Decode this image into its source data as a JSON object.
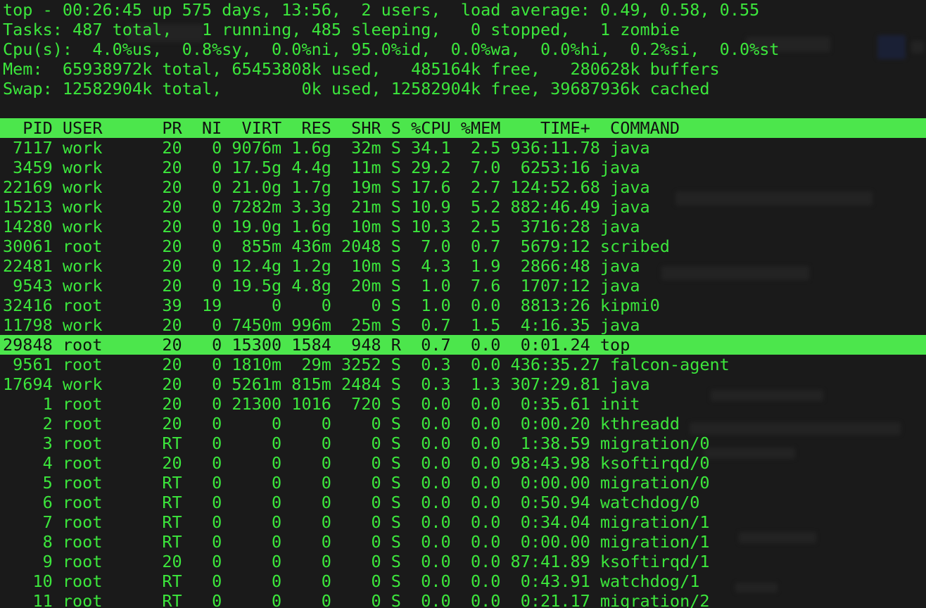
{
  "terminal": {
    "title": "top",
    "colors": {
      "background": "#1a1a1a",
      "foreground": "#3ce63c",
      "reverse_background": "#4ce64c",
      "reverse_foreground": "#111111"
    }
  },
  "summary": {
    "uptime_line": "top - 00:26:45 up 575 days, 13:56,  2 users,  load average: 0.49, 0.58, 0.55",
    "tasks_line": "Tasks: 487 total,   1 running, 485 sleeping,   0 stopped,   1 zombie",
    "cpu_line": "Cpu(s):  4.0%us,  0.8%sy,  0.0%ni, 95.0%id,  0.0%wa,  0.0%hi,  0.2%si,  0.0%st",
    "mem_line": "Mem:  65938972k total, 65453808k used,   485164k free,   280628k buffers",
    "swap_line": "Swap: 12582904k total,        0k used, 12582904k free, 39687936k cached",
    "fields": {
      "time": "00:26:45",
      "up": "575 days, 13:56",
      "users": "2",
      "load_average": [
        "0.49",
        "0.58",
        "0.55"
      ],
      "tasks_total": "487",
      "tasks_running": "1",
      "tasks_sleeping": "485",
      "tasks_stopped": "0",
      "tasks_zombie": "1",
      "cpu_us": "4.0",
      "cpu_sy": "0.8",
      "cpu_ni": "0.0",
      "cpu_id": "95.0",
      "cpu_wa": "0.0",
      "cpu_hi": "0.0",
      "cpu_si": "0.2",
      "cpu_st": "0.0",
      "mem_total": "65938972k",
      "mem_used": "65453808k",
      "mem_free": "485164k",
      "mem_buffers": "280628k",
      "swap_total": "12582904k",
      "swap_used": "0k",
      "swap_free": "12582904k",
      "swap_cached": "39687936k"
    }
  },
  "table": {
    "header_line": "  PID USER      PR  NI  VIRT  RES  SHR S %CPU %MEM    TIME+  COMMAND                 ",
    "columns": [
      "PID",
      "USER",
      "PR",
      "NI",
      "VIRT",
      "RES",
      "SHR",
      "S",
      "%CPU",
      "%MEM",
      "TIME+",
      "COMMAND"
    ],
    "selected_row_index": 10,
    "rows": [
      {
        "line": " 7117 work      20   0 9076m 1.6g  32m S 34.1  2.5 936:11.78 java",
        "pid": "7117",
        "user": "work",
        "pr": "20",
        "ni": "0",
        "virt": "9076m",
        "res": "1.6g",
        "shr": "32m",
        "s": "S",
        "cpu": "34.1",
        "mem": "2.5",
        "time": "936:11.78",
        "command": "java"
      },
      {
        "line": " 3459 work      20   0 17.5g 4.4g  11m S 29.2  7.0  6253:16 java",
        "pid": "3459",
        "user": "work",
        "pr": "20",
        "ni": "0",
        "virt": "17.5g",
        "res": "4.4g",
        "shr": "11m",
        "s": "S",
        "cpu": "29.2",
        "mem": "7.0",
        "time": "6253:16",
        "command": "java"
      },
      {
        "line": "22169 work      20   0 21.0g 1.7g  19m S 17.6  2.7 124:52.68 java",
        "pid": "22169",
        "user": "work",
        "pr": "20",
        "ni": "0",
        "virt": "21.0g",
        "res": "1.7g",
        "shr": "19m",
        "s": "S",
        "cpu": "17.6",
        "mem": "2.7",
        "time": "124:52.68",
        "command": "java"
      },
      {
        "line": "15213 work      20   0 7282m 3.3g  21m S 10.9  5.2 882:46.49 java",
        "pid": "15213",
        "user": "work",
        "pr": "20",
        "ni": "0",
        "virt": "7282m",
        "res": "3.3g",
        "shr": "21m",
        "s": "S",
        "cpu": "10.9",
        "mem": "5.2",
        "time": "882:46.49",
        "command": "java"
      },
      {
        "line": "14280 work      20   0 19.0g 1.6g  10m S 10.3  2.5  3716:28 java",
        "pid": "14280",
        "user": "work",
        "pr": "20",
        "ni": "0",
        "virt": "19.0g",
        "res": "1.6g",
        "shr": "10m",
        "s": "S",
        "cpu": "10.3",
        "mem": "2.5",
        "time": "3716:28",
        "command": "java"
      },
      {
        "line": "30061 root      20   0  855m 436m 2048 S  7.0  0.7  5679:12 scribed",
        "pid": "30061",
        "user": "root",
        "pr": "20",
        "ni": "0",
        "virt": "855m",
        "res": "436m",
        "shr": "2048",
        "s": "S",
        "cpu": "7.0",
        "mem": "0.7",
        "time": "5679:12",
        "command": "scribed"
      },
      {
        "line": "22481 work      20   0 12.4g 1.2g  10m S  4.3  1.9  2866:48 java",
        "pid": "22481",
        "user": "work",
        "pr": "20",
        "ni": "0",
        "virt": "12.4g",
        "res": "1.2g",
        "shr": "10m",
        "s": "S",
        "cpu": "4.3",
        "mem": "1.9",
        "time": "2866:48",
        "command": "java"
      },
      {
        "line": " 9543 work      20   0 19.5g 4.8g  20m S  1.0  7.6  1707:12 java",
        "pid": "9543",
        "user": "work",
        "pr": "20",
        "ni": "0",
        "virt": "19.5g",
        "res": "4.8g",
        "shr": "20m",
        "s": "S",
        "cpu": "1.0",
        "mem": "7.6",
        "time": "1707:12",
        "command": "java"
      },
      {
        "line": "32416 root      39  19     0    0    0 S  1.0  0.0  8813:26 kipmi0",
        "pid": "32416",
        "user": "root",
        "pr": "39",
        "ni": "19",
        "virt": "0",
        "res": "0",
        "shr": "0",
        "s": "S",
        "cpu": "1.0",
        "mem": "0.0",
        "time": "8813:26",
        "command": "kipmi0"
      },
      {
        "line": "11798 work      20   0 7450m 996m  25m S  0.7  1.5  4:16.35 java",
        "pid": "11798",
        "user": "work",
        "pr": "20",
        "ni": "0",
        "virt": "7450m",
        "res": "996m",
        "shr": "25m",
        "s": "S",
        "cpu": "0.7",
        "mem": "1.5",
        "time": "4:16.35",
        "command": "java"
      },
      {
        "line": "29848 root      20   0 15300 1584  948 R  0.7  0.0  0:01.24 top",
        "pid": "29848",
        "user": "root",
        "pr": "20",
        "ni": "0",
        "virt": "15300",
        "res": "1584",
        "shr": "948",
        "s": "R",
        "cpu": "0.7",
        "mem": "0.0",
        "time": "0:01.24",
        "command": "top"
      },
      {
        "line": " 9561 root      20   0 1810m  29m 3252 S  0.3  0.0 436:35.27 falcon-agent",
        "pid": "9561",
        "user": "root",
        "pr": "20",
        "ni": "0",
        "virt": "1810m",
        "res": "29m",
        "shr": "3252",
        "s": "S",
        "cpu": "0.3",
        "mem": "0.0",
        "time": "436:35.27",
        "command": "falcon-agent"
      },
      {
        "line": "17694 work      20   0 5261m 815m 2484 S  0.3  1.3 307:29.81 java",
        "pid": "17694",
        "user": "work",
        "pr": "20",
        "ni": "0",
        "virt": "5261m",
        "res": "815m",
        "shr": "2484",
        "s": "S",
        "cpu": "0.3",
        "mem": "1.3",
        "time": "307:29.81",
        "command": "java"
      },
      {
        "line": "    1 root      20   0 21300 1016  720 S  0.0  0.0  0:35.61 init",
        "pid": "1",
        "user": "root",
        "pr": "20",
        "ni": "0",
        "virt": "21300",
        "res": "1016",
        "shr": "720",
        "s": "S",
        "cpu": "0.0",
        "mem": "0.0",
        "time": "0:35.61",
        "command": "init"
      },
      {
        "line": "    2 root      20   0     0    0    0 S  0.0  0.0  0:00.20 kthreadd",
        "pid": "2",
        "user": "root",
        "pr": "20",
        "ni": "0",
        "virt": "0",
        "res": "0",
        "shr": "0",
        "s": "S",
        "cpu": "0.0",
        "mem": "0.0",
        "time": "0:00.20",
        "command": "kthreadd"
      },
      {
        "line": "    3 root      RT   0     0    0    0 S  0.0  0.0  1:38.59 migration/0",
        "pid": "3",
        "user": "root",
        "pr": "RT",
        "ni": "0",
        "virt": "0",
        "res": "0",
        "shr": "0",
        "s": "S",
        "cpu": "0.0",
        "mem": "0.0",
        "time": "1:38.59",
        "command": "migration/0"
      },
      {
        "line": "    4 root      20   0     0    0    0 S  0.0  0.0 98:43.98 ksoftirqd/0",
        "pid": "4",
        "user": "root",
        "pr": "20",
        "ni": "0",
        "virt": "0",
        "res": "0",
        "shr": "0",
        "s": "S",
        "cpu": "0.0",
        "mem": "0.0",
        "time": "98:43.98",
        "command": "ksoftirqd/0"
      },
      {
        "line": "    5 root      RT   0     0    0    0 S  0.0  0.0  0:00.00 migration/0",
        "pid": "5",
        "user": "root",
        "pr": "RT",
        "ni": "0",
        "virt": "0",
        "res": "0",
        "shr": "0",
        "s": "S",
        "cpu": "0.0",
        "mem": "0.0",
        "time": "0:00.00",
        "command": "migration/0"
      },
      {
        "line": "    6 root      RT   0     0    0    0 S  0.0  0.0  0:50.94 watchdog/0",
        "pid": "6",
        "user": "root",
        "pr": "RT",
        "ni": "0",
        "virt": "0",
        "res": "0",
        "shr": "0",
        "s": "S",
        "cpu": "0.0",
        "mem": "0.0",
        "time": "0:50.94",
        "command": "watchdog/0"
      },
      {
        "line": "    7 root      RT   0     0    0    0 S  0.0  0.0  0:34.04 migration/1",
        "pid": "7",
        "user": "root",
        "pr": "RT",
        "ni": "0",
        "virt": "0",
        "res": "0",
        "shr": "0",
        "s": "S",
        "cpu": "0.0",
        "mem": "0.0",
        "time": "0:34.04",
        "command": "migration/1"
      },
      {
        "line": "    8 root      RT   0     0    0    0 S  0.0  0.0  0:00.00 migration/1",
        "pid": "8",
        "user": "root",
        "pr": "RT",
        "ni": "0",
        "virt": "0",
        "res": "0",
        "shr": "0",
        "s": "S",
        "cpu": "0.0",
        "mem": "0.0",
        "time": "0:00.00",
        "command": "migration/1"
      },
      {
        "line": "    9 root      20   0     0    0    0 S  0.0  0.0 87:41.89 ksoftirqd/1",
        "pid": "9",
        "user": "root",
        "pr": "20",
        "ni": "0",
        "virt": "0",
        "res": "0",
        "shr": "0",
        "s": "S",
        "cpu": "0.0",
        "mem": "0.0",
        "time": "87:41.89",
        "command": "ksoftirqd/1"
      },
      {
        "line": "   10 root      RT   0     0    0    0 S  0.0  0.0  0:43.91 watchdog/1",
        "pid": "10",
        "user": "root",
        "pr": "RT",
        "ni": "0",
        "virt": "0",
        "res": "0",
        "shr": "0",
        "s": "S",
        "cpu": "0.0",
        "mem": "0.0",
        "time": "0:43.91",
        "command": "watchdog/1"
      },
      {
        "line": "   11 root      RT   0     0    0    0 S  0.0  0.0  0:21.17 migration/2",
        "pid": "11",
        "user": "root",
        "pr": "RT",
        "ni": "0",
        "virt": "0",
        "res": "0",
        "shr": "0",
        "s": "S",
        "cpu": "0.0",
        "mem": "0.0",
        "time": "0:21.17",
        "command": "migration/2"
      }
    ]
  }
}
